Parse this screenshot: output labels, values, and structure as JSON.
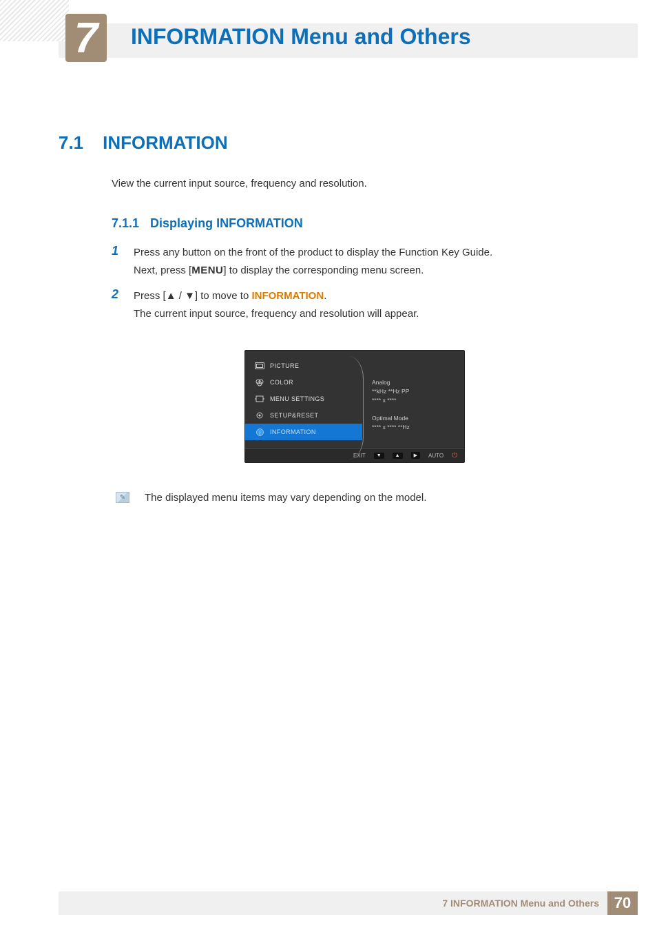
{
  "header": {
    "chapter_number": "7",
    "chapter_title": "INFORMATION Menu and Others"
  },
  "section": {
    "number": "7.1",
    "title": "INFORMATION",
    "intro": "View the current input source, frequency and resolution."
  },
  "subsection": {
    "number": "7.1.1",
    "title": "Displaying INFORMATION"
  },
  "steps": [
    {
      "num": "1",
      "line1": "Press any button on the front of the product to display the Function Key Guide.",
      "line2_pre": "Next, press [",
      "line2_menu": "MENU",
      "line2_post": "] to display the corresponding menu screen."
    },
    {
      "num": "2",
      "line1_pre": "Press [",
      "line1_post": "] to move to ",
      "line1_target": "INFORMATION",
      "line1_end": ".",
      "line2": "The current input source, frequency and resolution will appear."
    }
  ],
  "osd": {
    "menu": [
      "PICTURE",
      "COLOR",
      "MENU SETTINGS",
      "SETUP&RESET",
      "INFORMATION"
    ],
    "right": {
      "sig_title": "Analog",
      "sig_line1": "**kHz **Hz PP",
      "sig_line2": "**** x ****",
      "mode_title": "Optimal Mode",
      "mode_line": "**** x **** **Hz"
    },
    "footer": {
      "exit": "EXIT",
      "auto": "AUTO"
    }
  },
  "note": "The displayed menu items may vary depending on the model.",
  "footer": {
    "text": "7 INFORMATION Menu and Others",
    "page": "70"
  }
}
